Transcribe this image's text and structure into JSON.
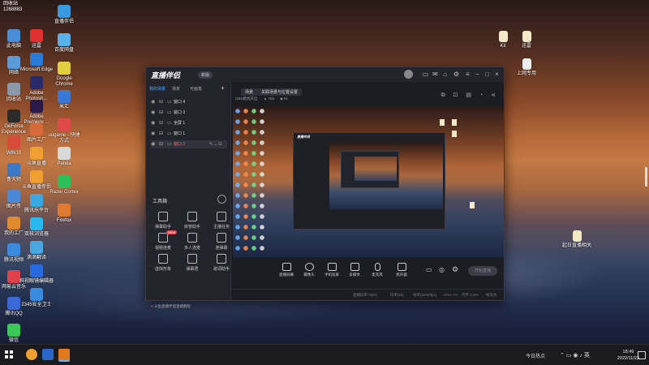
{
  "desktop": {
    "top_label": "回收站 1268883",
    "icons_col1": [
      "此电脑",
      "网络",
      "回收站",
      "GeForce Experience",
      "WIN10",
      "鲁大师",
      "图片传",
      "我的工厂",
      "腾讯视频",
      "网易云音乐",
      "腾讯QQ",
      "微信"
    ],
    "icons_col2": [
      "迅雷",
      "Microsoft Edge",
      "Adobe Photosh...",
      "Adobe Premiere ...",
      "图片工厂",
      "斗鱼直播",
      "斗鱼直播伴侣",
      "腾讯乐平台",
      "双核浏览器",
      "滴滴翻译",
      "斜视眼镜编辑器",
      "2345安全卫士"
    ],
    "icons_col3": [
      "直播伴侣",
      "百度网盘",
      "Google Chrome",
      "米汇",
      "uugame - 快捷方式",
      "Panda",
      "Razer Cortex",
      "Firefox"
    ],
    "right_icons": [
      "Kit",
      "迅雷",
      "上网专用",
      "起日直播相关"
    ]
  },
  "window": {
    "logo": "直播伴侣",
    "version": "新版",
    "left_tabs": [
      "我的场景",
      "场景",
      "可画笔"
    ],
    "scenes": [
      {
        "label": "窗口 4"
      },
      {
        "label": "窗口 3"
      },
      {
        "label": "全屏 1"
      },
      {
        "label": "窗口 1"
      },
      {
        "label": "窗口 2"
      }
    ],
    "tools_title": "工具箱",
    "tools": [
      {
        "label": "弹幕助手"
      },
      {
        "label": "房管助手"
      },
      {
        "label": "主播任务"
      },
      {
        "label": "视频连麦",
        "badge": "NEW"
      },
      {
        "label": "多人连麦"
      },
      {
        "label": "连弹幕"
      },
      {
        "label": "虚拟形象"
      },
      {
        "label": "弹幕君"
      },
      {
        "label": "歌词助手"
      }
    ],
    "bottom_note": "斗鱼直播伴侣直播教程",
    "chips": [
      "场景",
      "关联场景与位置设置"
    ],
    "meta": [
      "OBS模式开启",
      "759",
      "61"
    ],
    "toolbar": [
      "直播屏幕",
      "摄像头",
      "手机投屏",
      "多媒体",
      "麦克风",
      "扬声器"
    ],
    "golive": "开始直播",
    "status": [
      "直播码率 0kb/s",
      "码率(kb)",
      "帧率(30/30fps)",
      "CPU 7%",
      "内存 4.3%",
      "帧丢失"
    ]
  },
  "taskbar": {
    "weather": "今日热点",
    "time": "18:49",
    "date": "2022/11/23"
  }
}
